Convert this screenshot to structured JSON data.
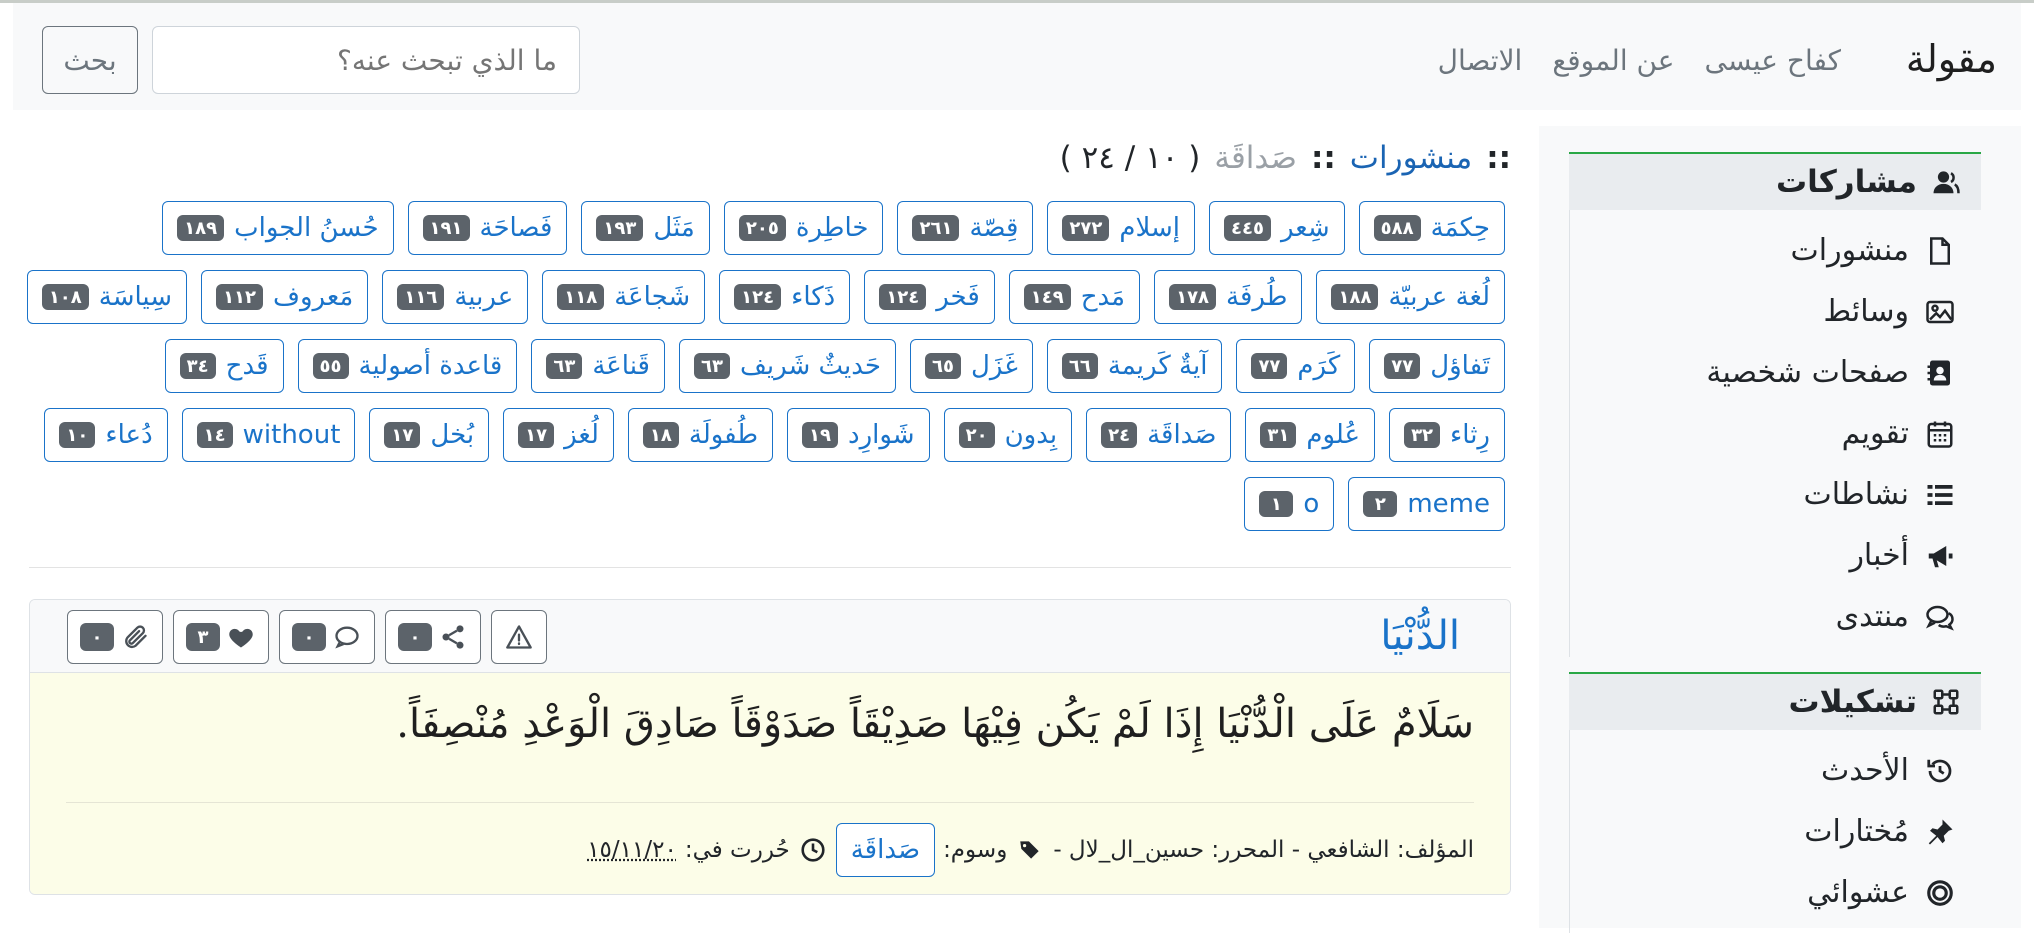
{
  "navbar": {
    "brand": "مقولة",
    "links": [
      "كفاح عيسى",
      "عن الموقع",
      "الاتصال"
    ],
    "search_placeholder": "ما الذي تبحث عنه؟",
    "search_button": "بحث"
  },
  "breadcrumb": {
    "sep": "::",
    "section": "منشورات",
    "current": "صَداقَة",
    "count": "( ١٠ / ٢٤ )"
  },
  "tag_rows": [
    [
      {
        "label": "حِكمَة",
        "count": "٥٨٨"
      },
      {
        "label": "شِعر",
        "count": "٤٤٥"
      },
      {
        "label": "إسلام",
        "count": "٢٧٢"
      },
      {
        "label": "قِصّة",
        "count": "٢٦١"
      },
      {
        "label": "خاطِرة",
        "count": "٢٠٥"
      },
      {
        "label": "مَثَل",
        "count": "١٩٣"
      },
      {
        "label": "فَصاحَة",
        "count": "١٩١"
      },
      {
        "label": "حُسنُ الجواب",
        "count": "١٨٩"
      }
    ],
    [
      {
        "label": "لُغة عربيّة",
        "count": "١٨٨"
      },
      {
        "label": "طُرفَة",
        "count": "١٧٨"
      },
      {
        "label": "مَدح",
        "count": "١٤٩"
      },
      {
        "label": "فَخر",
        "count": "١٢٤"
      },
      {
        "label": "ذَكاء",
        "count": "١٢٤"
      },
      {
        "label": "شَجاعَة",
        "count": "١١٨"
      },
      {
        "label": "عربية",
        "count": "١١٦"
      },
      {
        "label": "مَعروف",
        "count": "١١٢"
      },
      {
        "label": "سِياسَة",
        "count": "١٠٨"
      }
    ],
    [
      {
        "label": "تَفاؤل",
        "count": "٧٧"
      },
      {
        "label": "كَرَم",
        "count": "٧٧"
      },
      {
        "label": "آيةٌ كَريمة",
        "count": "٦٦"
      },
      {
        "label": "غَزَل",
        "count": "٦٥"
      },
      {
        "label": "حَديثٌ شَريف",
        "count": "٦٣"
      },
      {
        "label": "قَناعَة",
        "count": "٦٣"
      },
      {
        "label": "قاعدة أصولية",
        "count": "٥٥"
      },
      {
        "label": "قَدح",
        "count": "٣٤"
      }
    ],
    [
      {
        "label": "رِثاء",
        "count": "٣٢"
      },
      {
        "label": "عُلوم",
        "count": "٣١"
      },
      {
        "label": "صَداقَة",
        "count": "٢٤"
      },
      {
        "label": "بِدون",
        "count": "٢٠"
      },
      {
        "label": "شَوارِد",
        "count": "١٩"
      },
      {
        "label": "طُفولَة",
        "count": "١٨"
      },
      {
        "label": "لُغز",
        "count": "١٧"
      },
      {
        "label": "بُخل",
        "count": "١٧"
      },
      {
        "label": "without",
        "count": "١٤"
      },
      {
        "label": "دُعاء",
        "count": "١٠"
      }
    ],
    [
      {
        "label": "meme",
        "count": "٢"
      },
      {
        "label": "o",
        "count": "١"
      }
    ]
  ],
  "post": {
    "title": "الدُّنْيَا",
    "actions": {
      "attach": "٠",
      "like": "٣",
      "comment": "٠",
      "share": "٠"
    },
    "verse": "سَلَامٌ عَلَى الْدُّنْيَا إِذَا لَمْ يَكُن فِيْهَا صَدِيْقَاً صَدَوْقَاً صَادِقَ الْوَعْدِ مُنْصِفَاً.",
    "meta_author": "المؤلف: الشافعي - المحرر: حسين_ال_لال -",
    "meta_tags_label": "وسوم:",
    "meta_tag": "صَداقَة",
    "meta_date_label": "حُررت في:",
    "meta_date": "١٥/١١/٢٠"
  },
  "sidebar": {
    "section1_title": "مشاركات",
    "section1_items": [
      "منشورات",
      "وسائط",
      "صفحات شخصية",
      "تقويم",
      "نشاطات",
      "أخبار",
      "منتدى"
    ],
    "section2_title": "تشكيلات",
    "section2_items": [
      "الأحدث",
      "مُختارات",
      "عشوائي"
    ]
  }
}
